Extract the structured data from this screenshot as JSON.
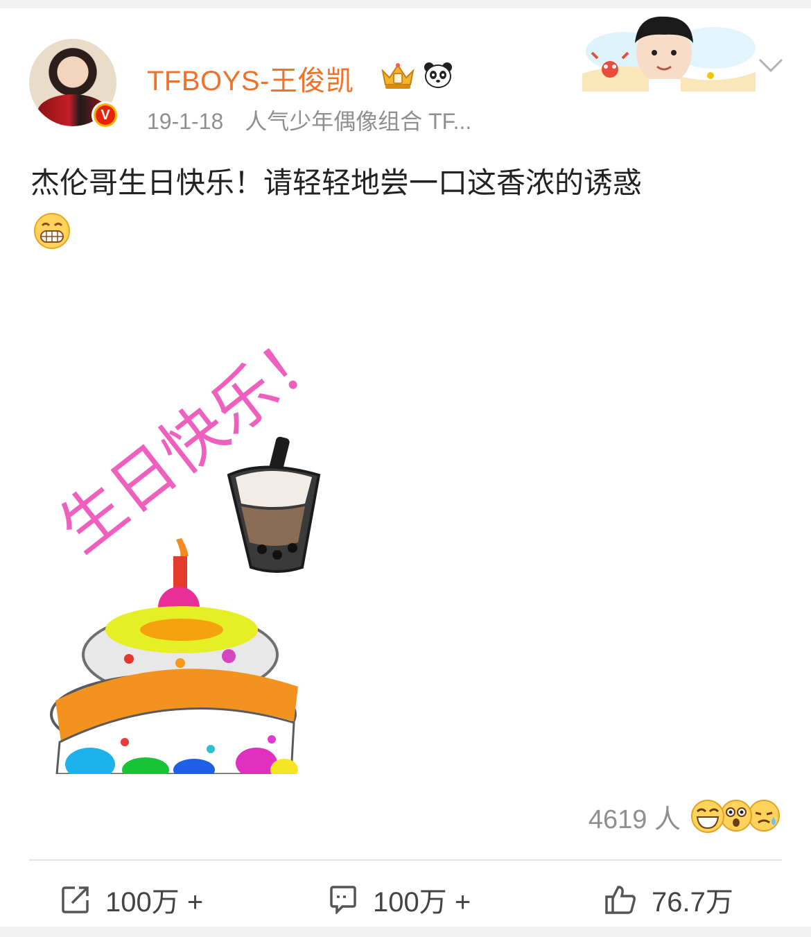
{
  "post": {
    "username": "TFBOYS-王俊凯",
    "date": "19-1-18",
    "source": "人气少年偶像组合 TF...",
    "verified_badge": "V",
    "text": "杰伦哥生日快乐！请轻轻地尝一口这香浓的诱惑",
    "image_text": "生日快乐！",
    "icons": {
      "username_badges": [
        "crown-badge-icon",
        "panda-icon"
      ],
      "text_emoji": "grin-emoji-icon",
      "more": "chevron-down-icon"
    }
  },
  "reactions": {
    "count_label": "4619 人",
    "emojis": [
      "laugh-emoji",
      "surprised-emoji",
      "sweat-emoji"
    ]
  },
  "actions": {
    "repost": "100万 +",
    "comment": "100万 +",
    "like": "76.7万"
  },
  "colors": {
    "username": "#f0712a",
    "meta": "#8f8f8f",
    "image_text": "#ee4fb8"
  }
}
